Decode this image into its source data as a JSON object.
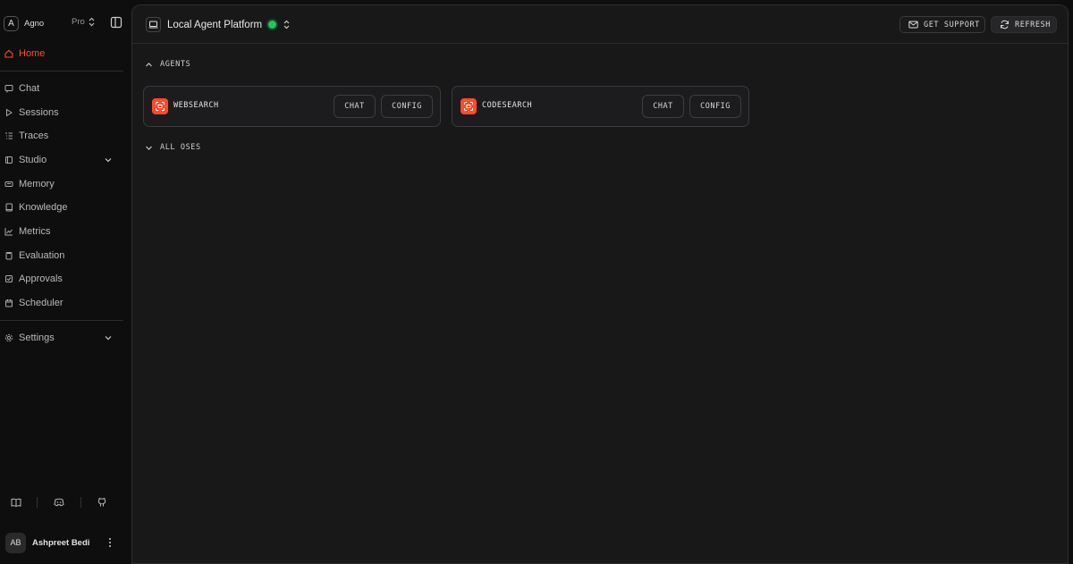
{
  "brand": {
    "initial": "A",
    "name": "Agno",
    "plan": "Pro"
  },
  "sidebar": {
    "home": "Home",
    "items": [
      {
        "label": "Chat",
        "icon": "chat-icon"
      },
      {
        "label": "Sessions",
        "icon": "play-icon"
      },
      {
        "label": "Traces",
        "icon": "list-icon"
      },
      {
        "label": "Studio",
        "icon": "studio-icon"
      },
      {
        "label": "Memory",
        "icon": "memory-icon"
      },
      {
        "label": "Knowledge",
        "icon": "book-icon"
      },
      {
        "label": "Metrics",
        "icon": "chart-icon"
      },
      {
        "label": "Evaluation",
        "icon": "clipboard-icon"
      },
      {
        "label": "Approvals",
        "icon": "check-square-icon"
      },
      {
        "label": "Scheduler",
        "icon": "calendar-icon"
      }
    ],
    "settings": "Settings"
  },
  "user": {
    "initials": "AB",
    "name": "Ashpreet Bedi"
  },
  "header": {
    "os_name": "Local Agent Platform",
    "status_color": "#22c55e",
    "support_label": "GET SUPPORT",
    "refresh_label": "REFRESH"
  },
  "sections": {
    "agents": "AGENTS",
    "all_oses": "ALL OSES"
  },
  "agents": [
    {
      "name": "WEBSEARCH",
      "chat": "CHAT",
      "config": "CONFIG"
    },
    {
      "name": "CODESEARCH",
      "chat": "CHAT",
      "config": "CONFIG"
    }
  ],
  "colors": {
    "accent": "#ff4a2b",
    "background": "#0e0e0f",
    "panel": "#181819"
  }
}
